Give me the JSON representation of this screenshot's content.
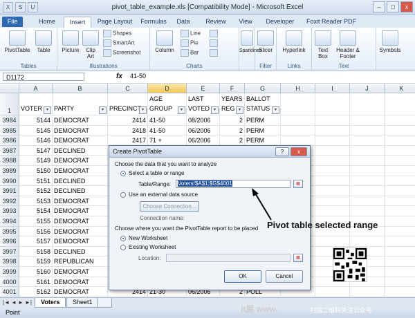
{
  "window": {
    "title": "pivot_table_example.xls [Compatibility Mode] - Microsoft Excel",
    "qat": [
      "X",
      "S",
      "U"
    ],
    "controls": [
      "–",
      "□",
      "x"
    ]
  },
  "ribbon_tabs": [
    "File",
    "Home",
    "Insert",
    "Page Layout",
    "Formulas",
    "Data",
    "Review",
    "View",
    "Developer",
    "Foxit Reader PDF"
  ],
  "ribbon": {
    "tables": {
      "group": "Tables",
      "pivottable": "PivotTable",
      "table": "Table"
    },
    "illustrations": {
      "group": "Illustrations",
      "picture": "Picture",
      "clipart": "Clip Art",
      "shapes": "Shapes",
      "smartart": "SmartArt",
      "screenshot": "Screenshot"
    },
    "charts": {
      "group": "Charts",
      "column": "Column",
      "line": "Line",
      "pie": "Pie",
      "bar": "Bar",
      "area": "Area",
      "scatter": "Scatter",
      "other": "Other Charts"
    },
    "sparklines": {
      "label": "Sparklines"
    },
    "filter": {
      "group": "Filter",
      "slicer": "Slicer"
    },
    "links": {
      "group": "Links",
      "hyperlink": "Hyperlink"
    },
    "text": {
      "group": "Text",
      "textbox": "Text Box",
      "header_footer": "Header & Footer"
    },
    "symbols": {
      "label": "Symbols"
    }
  },
  "formula_bar": {
    "name_box": "D1172",
    "fx": "fx",
    "value": "41-50"
  },
  "columns": [
    "A",
    "B",
    "C",
    "D",
    "E",
    "F",
    "G",
    "H",
    "I",
    "J",
    "K"
  ],
  "header_row": {
    "row": "1",
    "cells": [
      {
        "top": "",
        "bottom": "VOTER"
      },
      {
        "top": "",
        "bottom": "PARTY"
      },
      {
        "top": "",
        "bottom": "PRECINCT"
      },
      {
        "top": "AGE",
        "bottom": "GROUP"
      },
      {
        "top": "LAST",
        "bottom": "VOTED"
      },
      {
        "top": "YEARS",
        "bottom": "REG"
      },
      {
        "top": "BALLOT",
        "bottom": "STATUS"
      }
    ]
  },
  "rows": [
    {
      "row": "3984",
      "voter": "5144",
      "party": "DEMOCRAT",
      "precinct": "2414",
      "age": "41-50",
      "voted": "08/2006",
      "years": "2",
      "status": "PERM"
    },
    {
      "row": "3985",
      "voter": "5145",
      "party": "DEMOCRAT",
      "precinct": "2418",
      "age": "41-50",
      "voted": "06/2006",
      "years": "2",
      "status": "PERM"
    },
    {
      "row": "3986",
      "voter": "5146",
      "party": "DEMOCRAT",
      "precinct": "2417",
      "age": "71 +",
      "voted": "06/2006",
      "years": "2",
      "status": "PERM"
    },
    {
      "row": "3987",
      "voter": "5147",
      "party": "DECLINED",
      "precinct": "",
      "age": "",
      "voted": "",
      "years": "",
      "status": ""
    },
    {
      "row": "3988",
      "voter": "5149",
      "party": "DEMOCRAT",
      "precinct": "",
      "age": "",
      "voted": "",
      "years": "",
      "status": ""
    },
    {
      "row": "3989",
      "voter": "5150",
      "party": "DEMOCRAT",
      "precinct": "",
      "age": "",
      "voted": "",
      "years": "",
      "status": ""
    },
    {
      "row": "3990",
      "voter": "5151",
      "party": "DECLINED",
      "precinct": "",
      "age": "",
      "voted": "",
      "years": "",
      "status": ""
    },
    {
      "row": "3991",
      "voter": "5152",
      "party": "DECLINED",
      "precinct": "",
      "age": "",
      "voted": "",
      "years": "",
      "status": ""
    },
    {
      "row": "3992",
      "voter": "5153",
      "party": "DEMOCRAT",
      "precinct": "",
      "age": "",
      "voted": "",
      "years": "",
      "status": ""
    },
    {
      "row": "3993",
      "voter": "5154",
      "party": "DEMOCRAT",
      "precinct": "",
      "age": "",
      "voted": "",
      "years": "",
      "status": ""
    },
    {
      "row": "3994",
      "voter": "5155",
      "party": "DEMOCRAT",
      "precinct": "",
      "age": "",
      "voted": "",
      "years": "",
      "status": ""
    },
    {
      "row": "3995",
      "voter": "5156",
      "party": "DEMOCRAT",
      "precinct": "",
      "age": "",
      "voted": "",
      "years": "",
      "status": ""
    },
    {
      "row": "3996",
      "voter": "5157",
      "party": "DEMOCRAT",
      "precinct": "",
      "age": "",
      "voted": "",
      "years": "",
      "status": ""
    },
    {
      "row": "3997",
      "voter": "5158",
      "party": "DECLINED",
      "precinct": "",
      "age": "",
      "voted": "",
      "years": "",
      "status": ""
    },
    {
      "row": "3998",
      "voter": "5159",
      "party": "REPUBLICAN",
      "precinct": "",
      "age": "",
      "voted": "",
      "years": "",
      "status": ""
    },
    {
      "row": "3999",
      "voter": "5160",
      "party": "DEMOCRAT",
      "precinct": "",
      "age": "",
      "voted": "",
      "years": "",
      "status": ""
    },
    {
      "row": "4000",
      "voter": "5161",
      "party": "DEMOCRAT",
      "precinct": "",
      "age": "",
      "voted": "",
      "years": "",
      "status": ""
    },
    {
      "row": "4001",
      "voter": "5162",
      "party": "DEMOCRAT",
      "precinct": "2414",
      "age": "21-30",
      "voted": "06/2006",
      "years": "2",
      "status": "POLL"
    }
  ],
  "sheet_tabs": {
    "nav": [
      "|◄",
      "◄",
      "►",
      "►|"
    ],
    "tabs": [
      "Voters",
      "Sheet1"
    ]
  },
  "status": {
    "text": "Point"
  },
  "dialog": {
    "title": "Create PivotTable",
    "close": "x",
    "help": "?",
    "section1": "Choose the data that you want to analyze",
    "opt_select": "Select a table or range",
    "table_range_label": "Table/Range:",
    "table_range_value": "Voters!$A$1:$G$4001",
    "opt_external": "Use an external data source",
    "choose_connection": "Choose Connection...",
    "connection_name": "Connection name:",
    "section2": "Choose where you want the PivotTable report to be placed",
    "opt_new": "New Worksheet",
    "opt_existing": "Existing Worksheet",
    "location_label": "Location:",
    "ok": "OK",
    "cancel": "Cancel"
  },
  "annotation": "Pivot table selected range",
  "watermark": {
    "site": "it屋 www.",
    "text": "扫描二维码关注公众号"
  }
}
